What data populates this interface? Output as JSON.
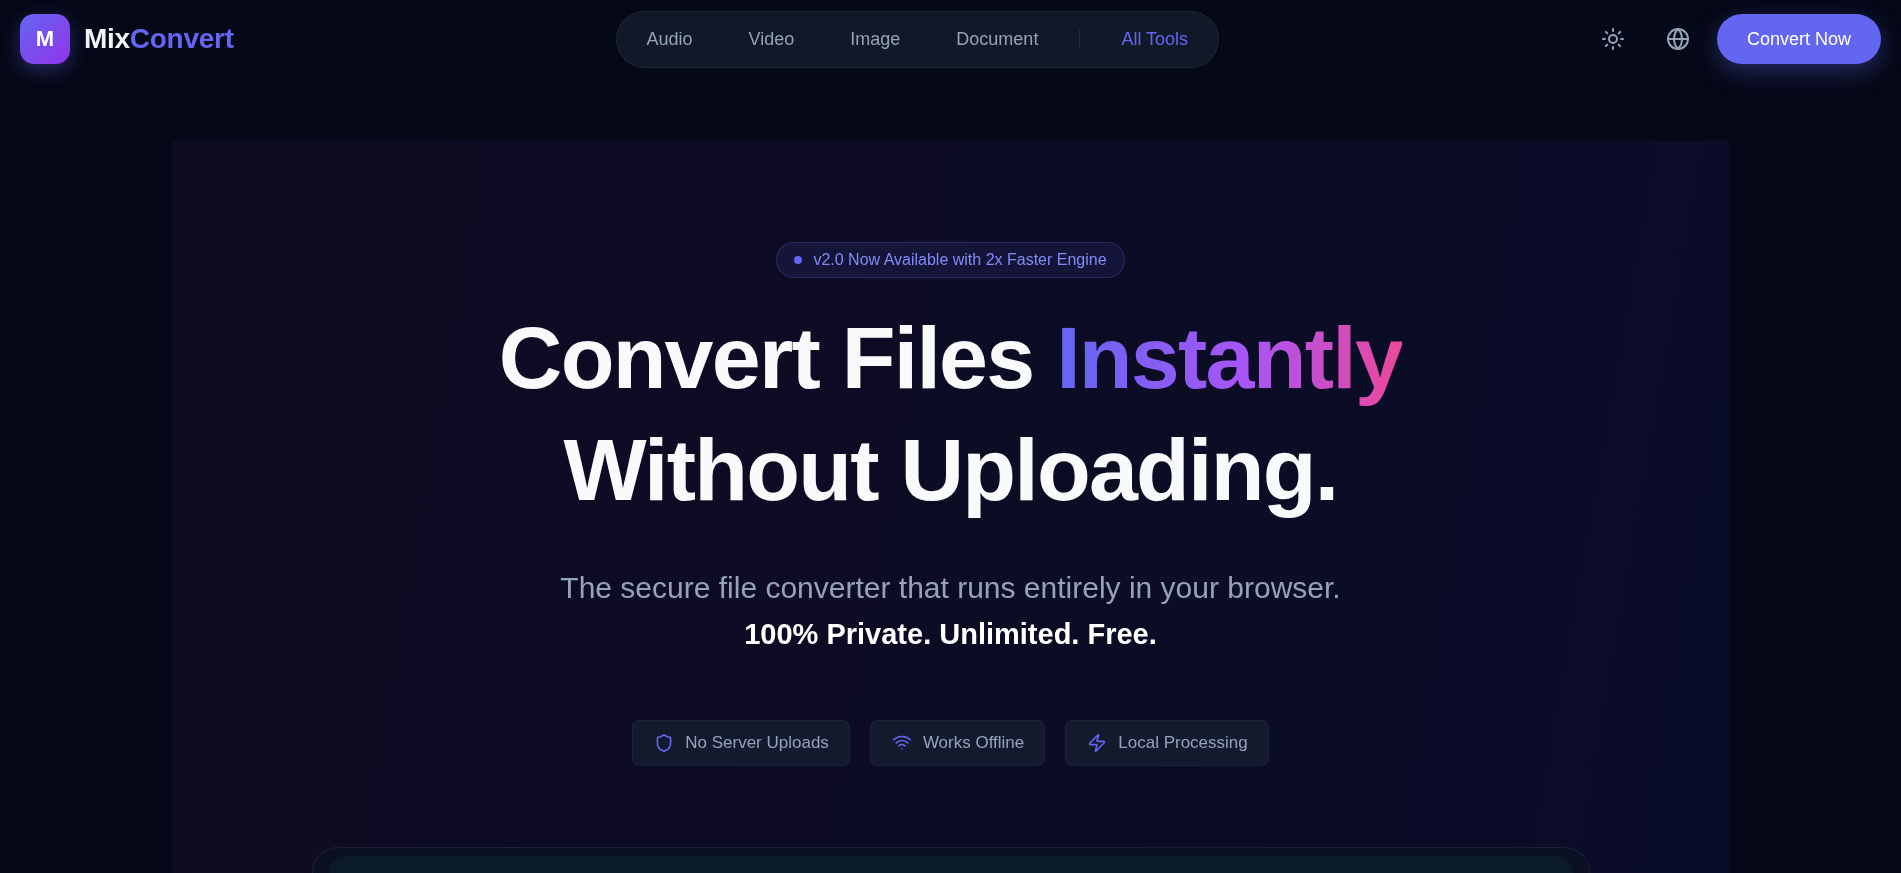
{
  "header": {
    "logo": {
      "mark": "M",
      "name": "Mix",
      "name_accent": "Convert"
    },
    "nav": [
      {
        "label": "Audio",
        "kind": "category"
      },
      {
        "label": "Video",
        "kind": "category"
      },
      {
        "label": "Image",
        "kind": "category"
      },
      {
        "label": "Document",
        "kind": "category"
      },
      {
        "label": "All Tools",
        "kind": "all"
      }
    ],
    "cta": "Convert Now"
  },
  "hero": {
    "badge": "v2.0 Now Available with 2x Faster Engine",
    "headline": {
      "lead": "Convert Files",
      "highlight": "Instantly",
      "tail": "Without Uploading."
    },
    "subtitle": "The secure file converter that runs entirely in your browser.",
    "tagline": "100% Private. Unlimited. Free.",
    "features": [
      {
        "label": "No Server Uploads"
      },
      {
        "label": "Works Offline"
      },
      {
        "label": "Local Processing"
      }
    ]
  }
}
